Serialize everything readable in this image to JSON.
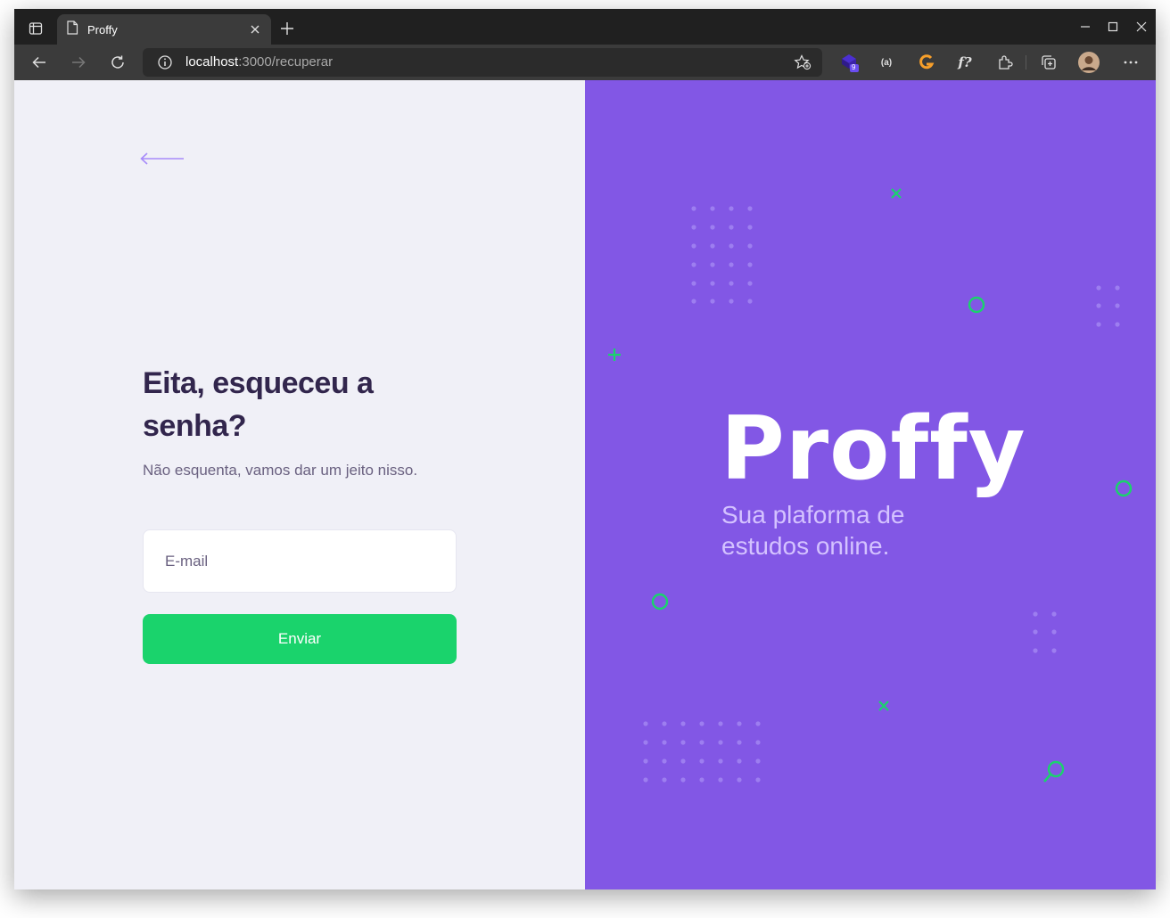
{
  "browser": {
    "tab_title": "Proffy",
    "url_host": "localhost",
    "url_rest": ":3000/recuperar",
    "extension_badge": "9",
    "extension_labels": [
      "(a)",
      "f?"
    ]
  },
  "form": {
    "title": "Eita, esqueceu a senha?",
    "subtitle": "Não esquenta, vamos dar um jeito nisso.",
    "email_placeholder": "E-mail",
    "submit_label": "Enviar"
  },
  "brand": {
    "name": "Proffy",
    "tagline": "Sua plaforma de estudos online."
  },
  "colors": {
    "left_bg": "#f0f0f7",
    "right_bg": "#8257e5",
    "accent_green": "#1ad36c",
    "heading": "#32264d",
    "text": "#6a6180",
    "tagline": "#d4c2ff"
  }
}
